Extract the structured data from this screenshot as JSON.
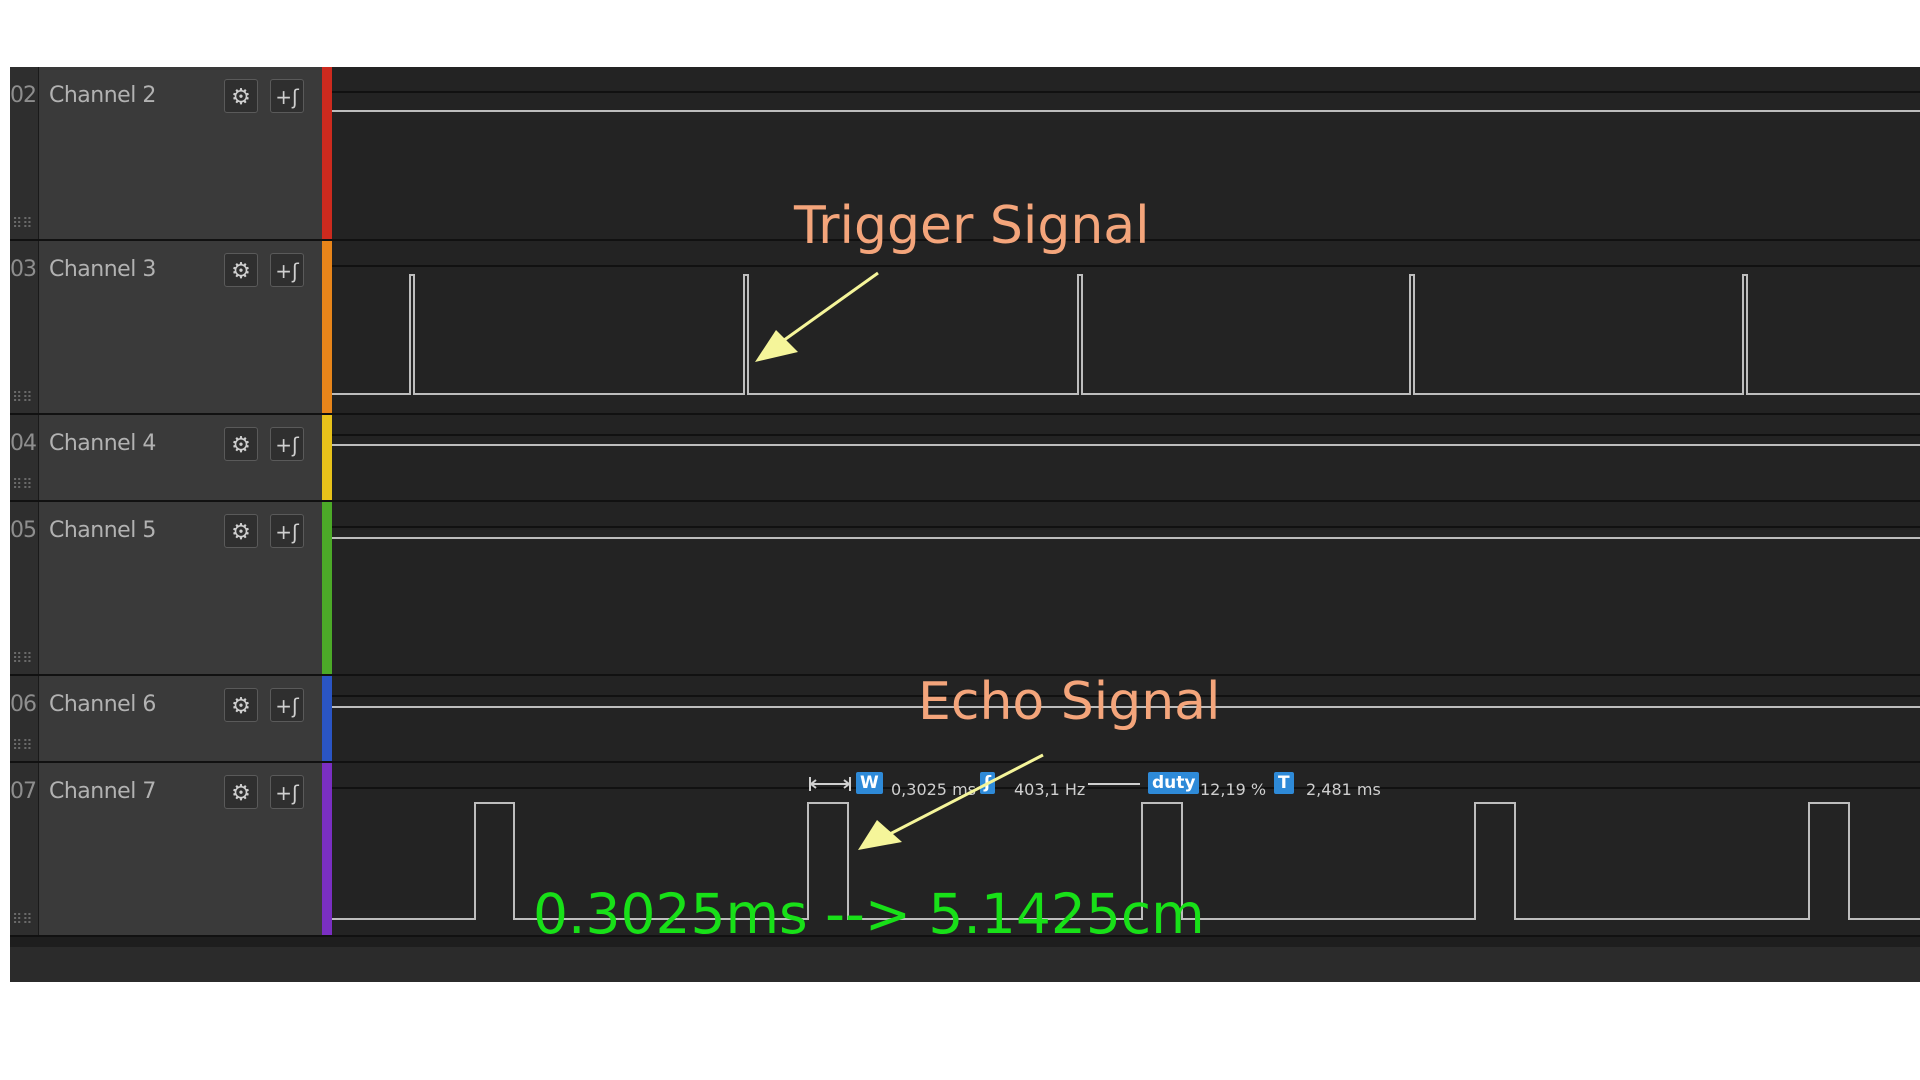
{
  "channels": [
    {
      "number": "02",
      "name": "Channel 2",
      "color": "#cc2a1e"
    },
    {
      "number": "03",
      "name": "Channel 3",
      "color": "#e8851a"
    },
    {
      "number": "04",
      "name": "Channel 4",
      "color": "#e8c21a"
    },
    {
      "number": "05",
      "name": "Channel 5",
      "color": "#4caa28"
    },
    {
      "number": "06",
      "name": "Channel 6",
      "color": "#2a55c4"
    },
    {
      "number": "07",
      "name": "Channel 7",
      "color": "#7a2fc2"
    }
  ],
  "icons": {
    "settings": "gear-icon",
    "trigger": "trigger-edge-icon"
  },
  "annotations": {
    "trigger": "Trigger Signal",
    "echo": "Echo Signal",
    "calc": "0.3025ms --> 5.1425cm",
    "arrow_color": "#f5f59a"
  },
  "measurements": {
    "width_badge": "W",
    "width_value": "0,3025 ms",
    "freq_value": "403,1 Hz",
    "duty_badge": "duty",
    "duty_value": "12,19 %",
    "period_badge": "T",
    "period_value": "2,481 ms"
  }
}
